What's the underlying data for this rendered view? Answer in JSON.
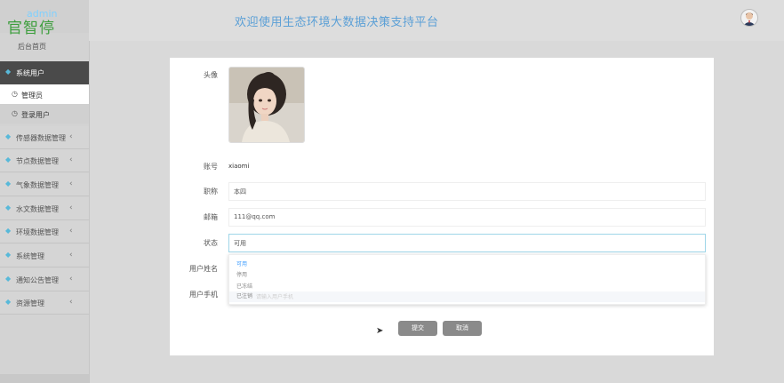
{
  "brand": {
    "admin": "admin",
    "name": "官智停"
  },
  "sidebar": {
    "home": "后台首页",
    "items": [
      {
        "label": "系统用户",
        "active": true
      },
      {
        "label": "传感器数据管理"
      },
      {
        "label": "节点数据管理"
      },
      {
        "label": "气象数据管理"
      },
      {
        "label": "水文数据管理"
      },
      {
        "label": "环境数据管理"
      },
      {
        "label": "系统管理"
      },
      {
        "label": "通知公告管理"
      },
      {
        "label": "资源管理"
      }
    ],
    "subitems": [
      {
        "label": "管理员"
      },
      {
        "label": "登录用户"
      }
    ]
  },
  "header": {
    "title": "欢迎使用生态环境大数据决策支持平台"
  },
  "form": {
    "avatar_label": "头像",
    "account_label": "账号",
    "account_value": "xiaomi",
    "role_label": "职称",
    "role_value": "本四",
    "email_label": "邮箱",
    "email_value": "111@qq.com",
    "status_label": "状态",
    "status_value": "可用",
    "username_label": "用户姓名",
    "phone_label": "用户手机",
    "status_options": [
      "可用",
      "停用",
      "已冻结",
      "已注销"
    ],
    "ghost_phone": "请输入用户手机",
    "submit": "提交",
    "cancel": "取消"
  },
  "colors": {
    "accent": "#409eff",
    "sidebar_active": "#4a4a4a",
    "header_title": "#5a9fd6"
  }
}
